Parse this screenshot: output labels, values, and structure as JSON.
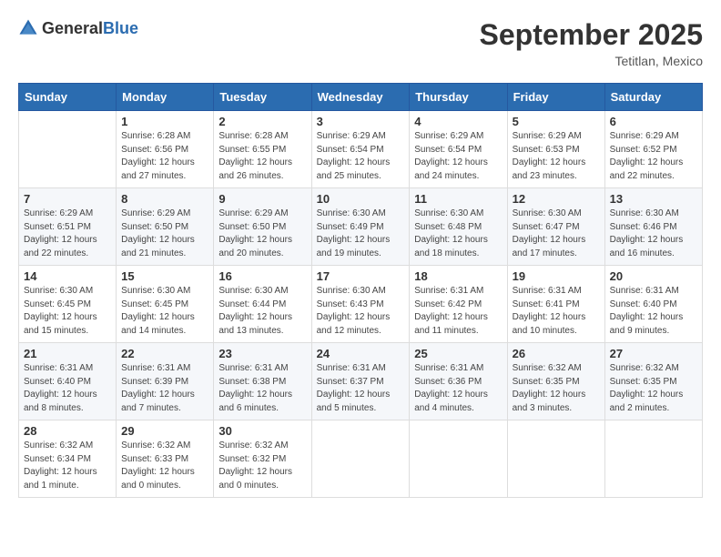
{
  "header": {
    "logo": {
      "general": "General",
      "blue": "Blue"
    },
    "title": "September 2025",
    "location": "Tetitlan, Mexico"
  },
  "days_of_week": [
    "Sunday",
    "Monday",
    "Tuesday",
    "Wednesday",
    "Thursday",
    "Friday",
    "Saturday"
  ],
  "weeks": [
    [
      null,
      {
        "day": 1,
        "sunrise": "6:28 AM",
        "sunset": "6:56 PM",
        "daylight": "12 hours and 27 minutes."
      },
      {
        "day": 2,
        "sunrise": "6:28 AM",
        "sunset": "6:55 PM",
        "daylight": "12 hours and 26 minutes."
      },
      {
        "day": 3,
        "sunrise": "6:29 AM",
        "sunset": "6:54 PM",
        "daylight": "12 hours and 25 minutes."
      },
      {
        "day": 4,
        "sunrise": "6:29 AM",
        "sunset": "6:54 PM",
        "daylight": "12 hours and 24 minutes."
      },
      {
        "day": 5,
        "sunrise": "6:29 AM",
        "sunset": "6:53 PM",
        "daylight": "12 hours and 23 minutes."
      },
      {
        "day": 6,
        "sunrise": "6:29 AM",
        "sunset": "6:52 PM",
        "daylight": "12 hours and 22 minutes."
      }
    ],
    [
      {
        "day": 7,
        "sunrise": "6:29 AM",
        "sunset": "6:51 PM",
        "daylight": "12 hours and 22 minutes."
      },
      {
        "day": 8,
        "sunrise": "6:29 AM",
        "sunset": "6:50 PM",
        "daylight": "12 hours and 21 minutes."
      },
      {
        "day": 9,
        "sunrise": "6:29 AM",
        "sunset": "6:50 PM",
        "daylight": "12 hours and 20 minutes."
      },
      {
        "day": 10,
        "sunrise": "6:30 AM",
        "sunset": "6:49 PM",
        "daylight": "12 hours and 19 minutes."
      },
      {
        "day": 11,
        "sunrise": "6:30 AM",
        "sunset": "6:48 PM",
        "daylight": "12 hours and 18 minutes."
      },
      {
        "day": 12,
        "sunrise": "6:30 AM",
        "sunset": "6:47 PM",
        "daylight": "12 hours and 17 minutes."
      },
      {
        "day": 13,
        "sunrise": "6:30 AM",
        "sunset": "6:46 PM",
        "daylight": "12 hours and 16 minutes."
      }
    ],
    [
      {
        "day": 14,
        "sunrise": "6:30 AM",
        "sunset": "6:45 PM",
        "daylight": "12 hours and 15 minutes."
      },
      {
        "day": 15,
        "sunrise": "6:30 AM",
        "sunset": "6:45 PM",
        "daylight": "12 hours and 14 minutes."
      },
      {
        "day": 16,
        "sunrise": "6:30 AM",
        "sunset": "6:44 PM",
        "daylight": "12 hours and 13 minutes."
      },
      {
        "day": 17,
        "sunrise": "6:30 AM",
        "sunset": "6:43 PM",
        "daylight": "12 hours and 12 minutes."
      },
      {
        "day": 18,
        "sunrise": "6:31 AM",
        "sunset": "6:42 PM",
        "daylight": "12 hours and 11 minutes."
      },
      {
        "day": 19,
        "sunrise": "6:31 AM",
        "sunset": "6:41 PM",
        "daylight": "12 hours and 10 minutes."
      },
      {
        "day": 20,
        "sunrise": "6:31 AM",
        "sunset": "6:40 PM",
        "daylight": "12 hours and 9 minutes."
      }
    ],
    [
      {
        "day": 21,
        "sunrise": "6:31 AM",
        "sunset": "6:40 PM",
        "daylight": "12 hours and 8 minutes."
      },
      {
        "day": 22,
        "sunrise": "6:31 AM",
        "sunset": "6:39 PM",
        "daylight": "12 hours and 7 minutes."
      },
      {
        "day": 23,
        "sunrise": "6:31 AM",
        "sunset": "6:38 PM",
        "daylight": "12 hours and 6 minutes."
      },
      {
        "day": 24,
        "sunrise": "6:31 AM",
        "sunset": "6:37 PM",
        "daylight": "12 hours and 5 minutes."
      },
      {
        "day": 25,
        "sunrise": "6:31 AM",
        "sunset": "6:36 PM",
        "daylight": "12 hours and 4 minutes."
      },
      {
        "day": 26,
        "sunrise": "6:32 AM",
        "sunset": "6:35 PM",
        "daylight": "12 hours and 3 minutes."
      },
      {
        "day": 27,
        "sunrise": "6:32 AM",
        "sunset": "6:35 PM",
        "daylight": "12 hours and 2 minutes."
      }
    ],
    [
      {
        "day": 28,
        "sunrise": "6:32 AM",
        "sunset": "6:34 PM",
        "daylight": "12 hours and 1 minute."
      },
      {
        "day": 29,
        "sunrise": "6:32 AM",
        "sunset": "6:33 PM",
        "daylight": "12 hours and 0 minutes."
      },
      {
        "day": 30,
        "sunrise": "6:32 AM",
        "sunset": "6:32 PM",
        "daylight": "12 hours and 0 minutes."
      },
      null,
      null,
      null,
      null
    ]
  ],
  "labels": {
    "sunrise": "Sunrise:",
    "sunset": "Sunset:",
    "daylight": "Daylight:"
  }
}
